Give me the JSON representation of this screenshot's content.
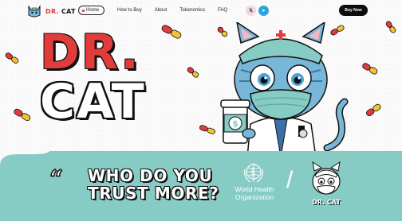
{
  "brand": {
    "logo_primary": "DR.",
    "logo_secondary": "CAT",
    "accent": "#e23b3b"
  },
  "nav": {
    "items": [
      {
        "label": "Home",
        "active": true
      },
      {
        "label": "How to Buy",
        "active": false
      },
      {
        "label": "About",
        "active": false
      },
      {
        "label": "Tokenomics",
        "active": false
      },
      {
        "label": "FAQ",
        "active": false
      }
    ],
    "social": [
      {
        "icon": "x-icon",
        "glyph": "𝕏"
      },
      {
        "icon": "telegram-icon",
        "glyph": "➤"
      }
    ],
    "buy_label": "Buy Now"
  },
  "hero": {
    "title_line1": "DR.",
    "title_line2": "CAT",
    "cup_symbol": "$"
  },
  "banner": {
    "quote_mark": "“",
    "slogan_line1": "WHO DO YOU",
    "slogan_line2": "TRUST MORE?",
    "who_line1": "World Health",
    "who_line2": "Organization",
    "separator": "/",
    "drcat_label": "DR. CAT",
    "background": "#86cbc4"
  },
  "colors": {
    "pill_red": "#e23b3b",
    "pill_yellow": "#f2c230",
    "teal": "#86cbc4",
    "cat_blue": "#79b7d8"
  }
}
